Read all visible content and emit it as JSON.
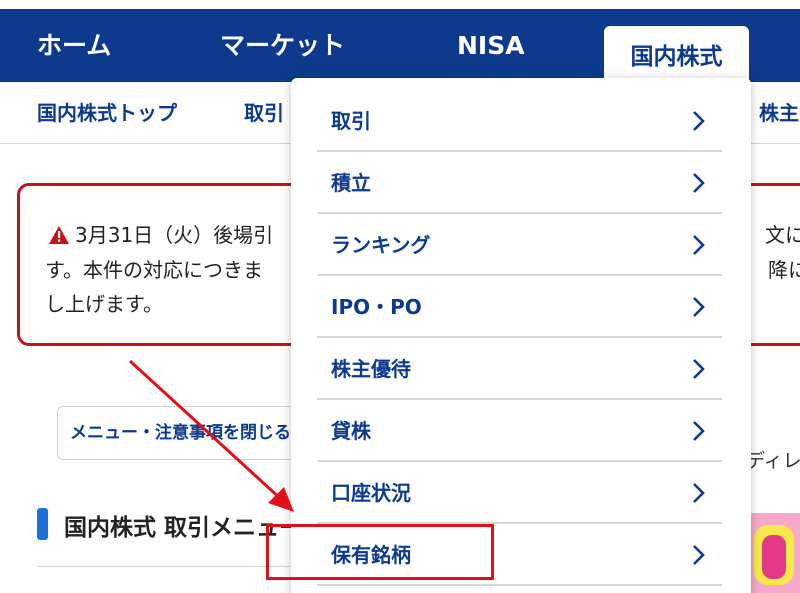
{
  "topnav": {
    "items": [
      {
        "label": "ホーム"
      },
      {
        "label": "マーケット"
      },
      {
        "label": "NISA"
      },
      {
        "label": "国内株式"
      }
    ]
  },
  "subnav": {
    "items": [
      {
        "label": "国内株式トップ"
      },
      {
        "label": "取引"
      },
      {
        "label": "株主"
      }
    ]
  },
  "notice": {
    "line1_left": "3月31日（火）後場引",
    "line1_right": "文にa",
    "line2_left": "す。本件の対応につきま",
    "line2_right": "降に",
    "line3": "し上げます。"
  },
  "menu_toggle": {
    "label": "メニュー・注意事項を閉じる"
  },
  "section": {
    "title": "国内株式 取引メニュー"
  },
  "side_text": "ディレ",
  "dropdown": {
    "items": [
      {
        "label": "取引"
      },
      {
        "label": "積立"
      },
      {
        "label": "ランキング"
      },
      {
        "label": "IPO・PO"
      },
      {
        "label": "株主優待"
      },
      {
        "label": "貸株"
      },
      {
        "label": "口座状況"
      },
      {
        "label": "保有銘柄"
      }
    ]
  },
  "colors": {
    "brand_navy": "#0d3a8c",
    "alert_red": "#c0151b",
    "annotation_red": "#e0101a",
    "accent_blue": "#1d6fd8"
  }
}
